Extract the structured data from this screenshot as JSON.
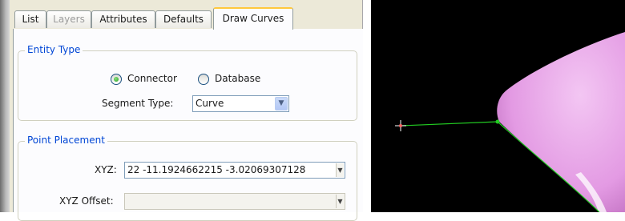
{
  "tabs": [
    {
      "label": "List"
    },
    {
      "label": "Layers"
    },
    {
      "label": "Attributes"
    },
    {
      "label": "Defaults"
    },
    {
      "label": "Draw Curves"
    }
  ],
  "entity_type": {
    "title": "Entity Type",
    "options": [
      {
        "label": "Connector",
        "selected": true
      },
      {
        "label": "Database",
        "selected": false
      }
    ],
    "segment_type_label": "Segment Type:",
    "segment_type_value": "Curve"
  },
  "point_placement": {
    "title": "Point Placement",
    "xyz_label": "XYZ:",
    "xyz_value": "22 -11.1924662215 -3.02069307128",
    "offset_label": "XYZ Offset:",
    "offset_value": ""
  },
  "viewport": {
    "background": "#000000",
    "connector_color": "#22cc22",
    "surface_color": "#e59ae5"
  }
}
